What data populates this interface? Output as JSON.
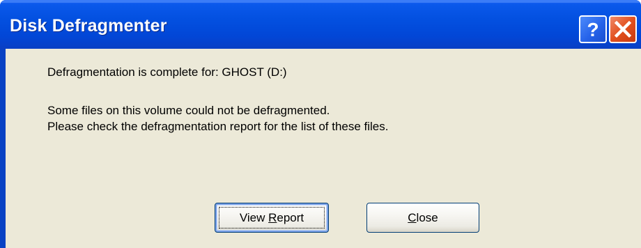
{
  "window": {
    "title": "Disk Defragmenter",
    "controls": {
      "help_glyph": "?",
      "help_icon": "question-mark-icon",
      "close_icon": "close-x-icon"
    },
    "colors": {
      "titlebar": "#0350e0",
      "client": "#ece9d8",
      "close_button": "#e2501f",
      "help_button": "#2663ea"
    }
  },
  "message": {
    "line1": "Defragmentation is complete for: GHOST (D:)",
    "line2": "Some files on this volume could not be defragmented.",
    "line3": "Please check the defragmentation report for the list of these files."
  },
  "buttons": {
    "view_report": {
      "label_before": "View ",
      "label_accel": "R",
      "label_after": "eport"
    },
    "close": {
      "label_before": "",
      "label_accel": "C",
      "label_after": "lose"
    }
  }
}
